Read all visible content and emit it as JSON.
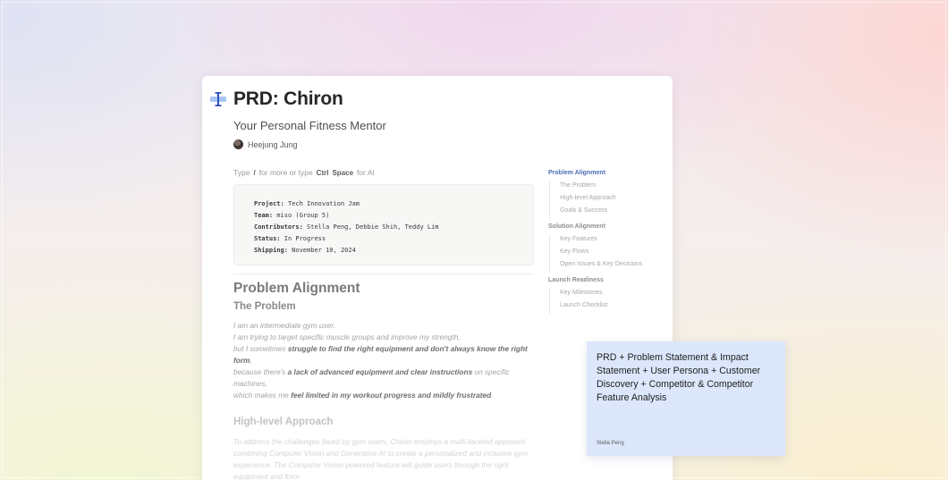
{
  "document": {
    "title": "PRD: Chiron",
    "icon": "text-cursor-icon",
    "subtitle": "Your Personal Fitness Mentor",
    "author": "Heejung Jung",
    "hint": {
      "prefix": "Type",
      "slash": "/",
      "middle": "for more or type",
      "key1": "Ctrl",
      "key2": "Space",
      "suffix": "for AI"
    },
    "meta": [
      {
        "label": "Project:",
        "value": "Tech Innovation Jam"
      },
      {
        "label": "Team:",
        "value": "miso (Group 5)"
      },
      {
        "label": "Contributors:",
        "value": "Stella Peng, Debbie Shih, Teddy Lim"
      },
      {
        "label": "Status:",
        "value": "In Progress"
      },
      {
        "label": "Shipping:",
        "value": "November 10, 2024"
      }
    ],
    "section_heading": "Problem Alignment",
    "problem_heading": "The Problem",
    "problem_text": {
      "l1": "I am an intermediate gym user.",
      "l2": "I am trying to target specific muscle groups and improve my strength,",
      "l3a": "but I sometimes ",
      "l3b": "struggle to find the right equipment and don't always know the right form",
      "l3c": ",",
      "l4a": "because there's ",
      "l4b": "a lack of advanced equipment and clear instructions",
      "l4c": " on specific machines,",
      "l5a": "which makes me ",
      "l5b": "feel limited in my workout progress and mildly frustrated",
      "l5c": "."
    },
    "approach_heading": "High-level Approach",
    "approach_text": "To address the challenges faced by gym users, Chiron employs a multi-faceted approach combining Computer Vision and Generative AI to create a personalized and inclusive gym experience. The Computer Vision-powered feature will guide users through the right equipment and form"
  },
  "toc": [
    {
      "label": "Problem Alignment",
      "active": true,
      "items": [
        "The Problem",
        "High-level Approach",
        "Goals & Success"
      ]
    },
    {
      "label": "Solution Alignment",
      "active": false,
      "items": [
        "Key Features",
        "Key Flows",
        "Open Issues & Key Decisions"
      ]
    },
    {
      "label": "Launch Readiness",
      "active": false,
      "items": [
        "Key Milestones",
        "Launch Checklist"
      ]
    }
  ],
  "sticky_note": {
    "text": "PRD + Problem Statement & Impact Statement + User Persona + Customer Discovery + Competitor & Competitor Feature Analysis",
    "author": "Stella Peng",
    "color": "#dce7fc"
  }
}
